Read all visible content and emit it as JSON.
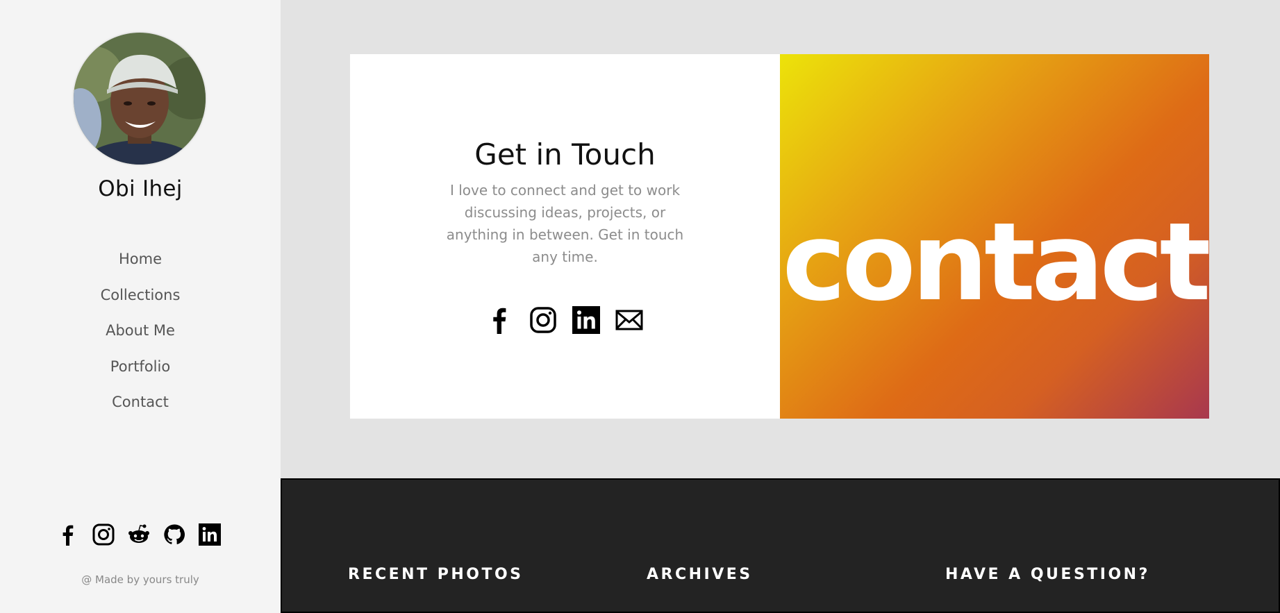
{
  "sidebar": {
    "name": "Obi Ihej",
    "nav": [
      {
        "label": "Home"
      },
      {
        "label": "Collections"
      },
      {
        "label": "About Me"
      },
      {
        "label": "Portfolio"
      },
      {
        "label": "Contact"
      }
    ],
    "social_icons": [
      "facebook-icon",
      "instagram-icon",
      "reddit-icon",
      "github-icon",
      "linkedin-icon"
    ],
    "credit": "@ Made by yours truly"
  },
  "contact": {
    "title": "Get in Touch",
    "text": "I love to connect and get to work discussing ideas, projects, or anything in between. Get in touch any time.",
    "social_icons": [
      "facebook-icon",
      "instagram-icon",
      "linkedin-icon",
      "mail-icon"
    ],
    "banner_word": "contact",
    "gradient": [
      "#ece30a",
      "#de6b16",
      "#a8384e"
    ]
  },
  "footer": {
    "columns": [
      {
        "heading": "RECENT PHOTOS"
      },
      {
        "heading": "ARCHIVES"
      },
      {
        "heading": "HAVE A QUESTION?"
      }
    ]
  },
  "colors": {
    "sidebar_bg": "#f4f4f4",
    "page_bg": "#e3e3e3",
    "footer_bg": "#232323"
  }
}
